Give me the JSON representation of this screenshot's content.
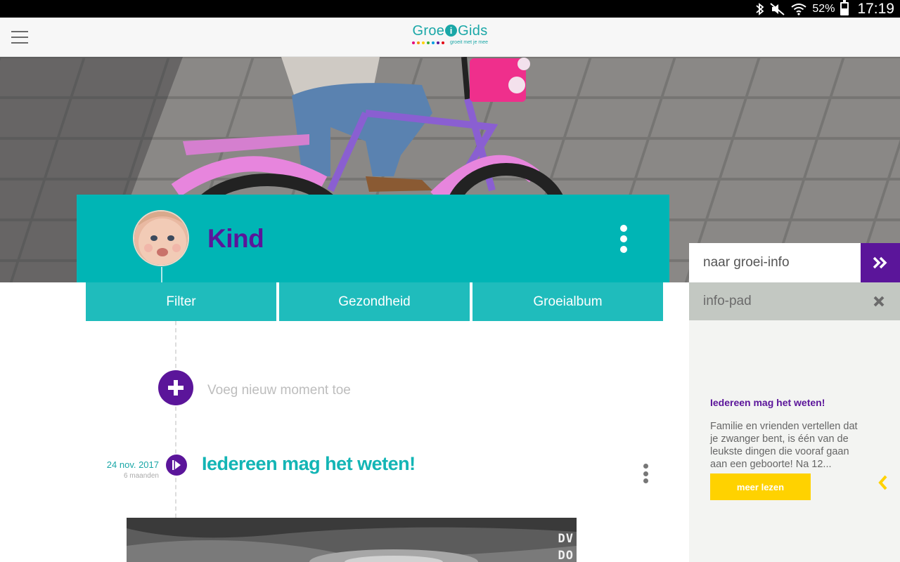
{
  "status_bar": {
    "icons": [
      "bluetooth-icon",
      "mute-icon",
      "wifi-icon",
      "battery-icon"
    ],
    "battery_percent": "52%",
    "battery_level": 0.52,
    "time": "17:19"
  },
  "header": {
    "menu_icon": "hamburger-menu-icon",
    "logo_prefix": "Groe",
    "logo_i": "i",
    "logo_suffix": "Gids",
    "logo_tagline": "groeit met je mee",
    "logo_dot_colors": [
      "#e6007e",
      "#f39200",
      "#ffd200",
      "#3aaa35",
      "#009fe3",
      "#5b159a",
      "#e30613"
    ]
  },
  "profile": {
    "name": "Kind",
    "options_icon": "more-vertical-icon"
  },
  "tabs": [
    {
      "label": "Filter"
    },
    {
      "label": "Gezondheid"
    },
    {
      "label": "Groeialbum"
    }
  ],
  "timeline": {
    "add_icon": "plus-icon",
    "add_label": "Voeg nieuw moment toe",
    "moments": [
      {
        "date": "24 nov. 2017",
        "age": "6 maanden",
        "icon": "flag-icon",
        "title": "Iedereen mag het weten!",
        "options_icon": "more-vertical-icon",
        "photo_overlay_lines": [
          "DV",
          "DO"
        ]
      }
    ]
  },
  "side_panel": {
    "link_label": "naar groei-info",
    "link_icon": "double-chevron-right-icon",
    "section_label": "info-pad",
    "close_icon": "close-icon",
    "article": {
      "title": "Iedereen mag het weten!",
      "body": "Familie en vrienden vertellen dat je zwanger bent, is één van de leukste dingen die vooraf gaan aan een geboorte! Na 12...",
      "button_label": "meer lezen"
    },
    "prev_icon": "chevron-left-icon"
  },
  "colors": {
    "brand_teal": "#00b5b5",
    "tab_teal": "#1fbcbc",
    "brand_purple": "#5b159a",
    "accent_yellow": "#ffd200",
    "panel_grey": "#c3c8c2"
  }
}
